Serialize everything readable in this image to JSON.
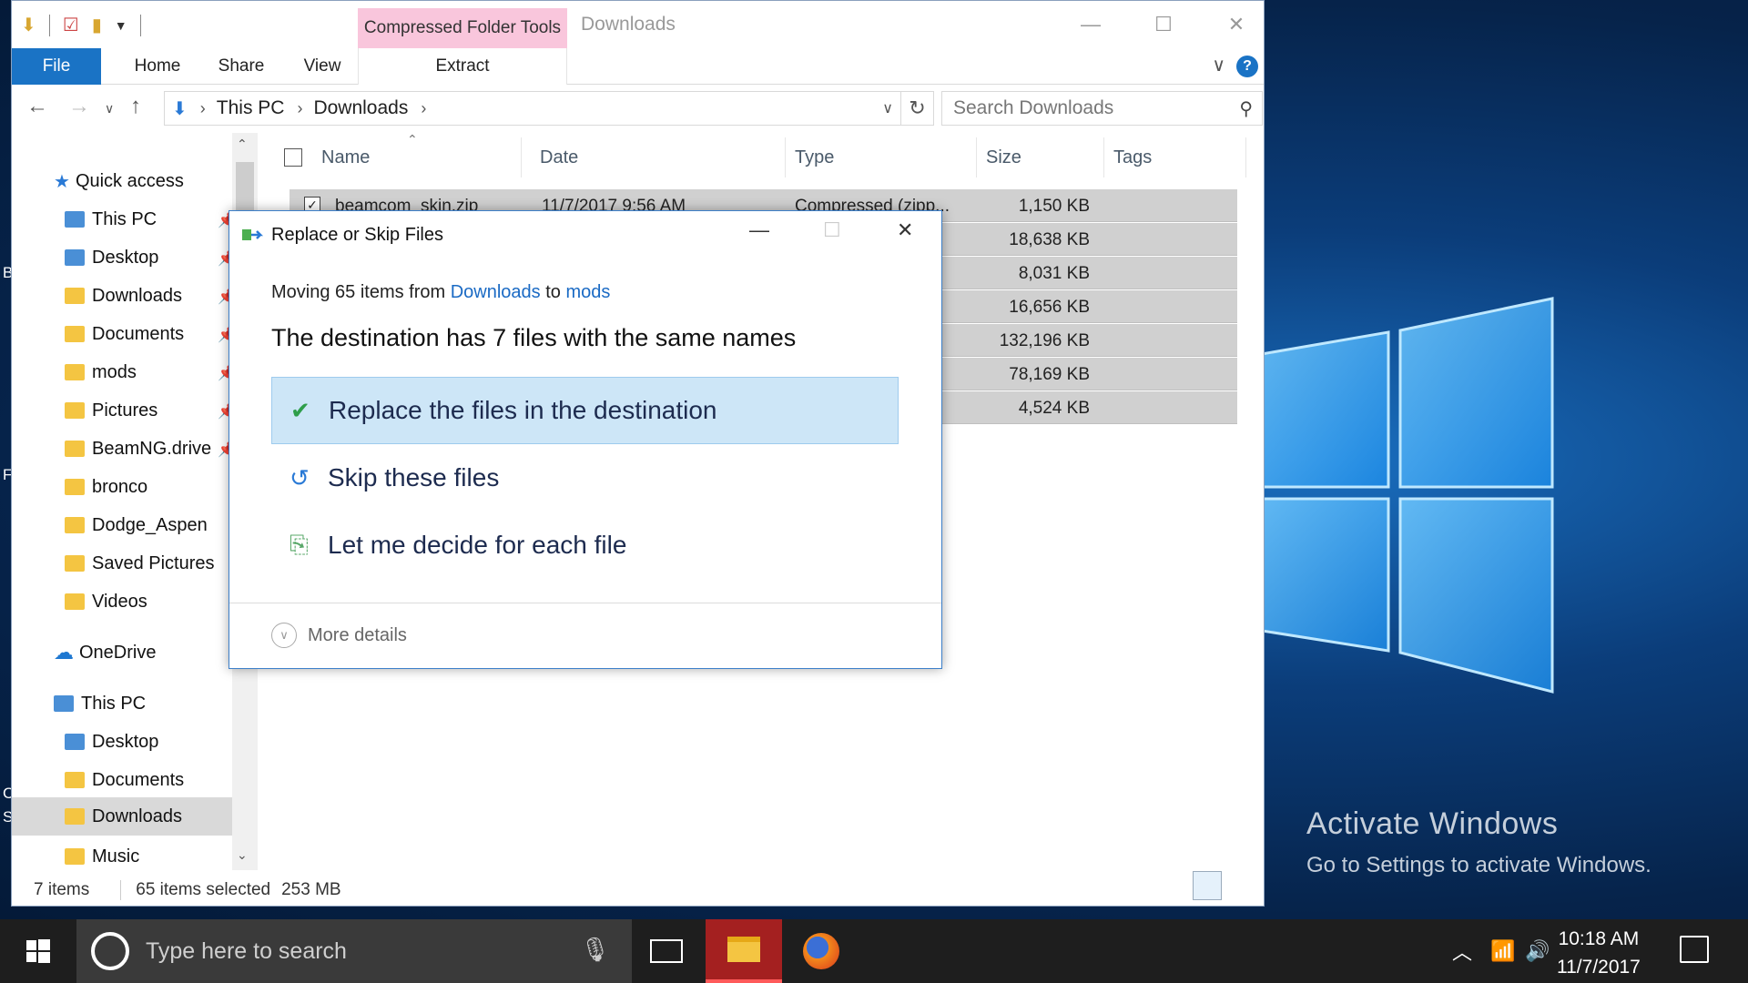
{
  "window": {
    "title": "Downloads",
    "contextual_tab": "Compressed Folder Tools",
    "ribbon_tabs": [
      "File",
      "Home",
      "Share",
      "View"
    ],
    "extract_tab": "Extract",
    "help": "?"
  },
  "address": {
    "crumbs": [
      "This PC",
      "Downloads"
    ],
    "search_placeholder": "Search Downloads"
  },
  "nav": {
    "quick_access": "Quick access",
    "items": [
      "This PC",
      "Desktop",
      "Downloads",
      "Documents",
      "mods",
      "Pictures",
      "BeamNG.drive",
      "bronco",
      "Dodge_Aspen",
      "Saved Pictures",
      "Videos"
    ],
    "onedrive": "OneDrive",
    "this_pc": "This PC",
    "pc_items": [
      "Desktop",
      "Documents",
      "Downloads",
      "Music"
    ]
  },
  "columns": [
    "Name",
    "Date",
    "Type",
    "Size",
    "Tags"
  ],
  "files": [
    {
      "name": "beamcom_skin.zip",
      "date": "11/7/2017 9:56 AM",
      "type": "Compressed (zipp...",
      "size": "1,150 KB"
    },
    {
      "name": "",
      "date": "",
      "type": "",
      "size": "18,638 KB"
    },
    {
      "name": "",
      "date": "",
      "type": "",
      "size": "8,031 KB"
    },
    {
      "name": "",
      "date": "",
      "type": "",
      "size": "16,656 KB"
    },
    {
      "name": "",
      "date": "",
      "type": "",
      "size": "132,196 KB"
    },
    {
      "name": "",
      "date": "",
      "type": "",
      "size": "78,169 KB"
    },
    {
      "name": "",
      "date": "",
      "type": "",
      "size": "4,524 KB"
    }
  ],
  "status": {
    "items": "7 items",
    "selected": "65 items selected",
    "size": "253 MB"
  },
  "dialog": {
    "title": "Replace or Skip Files",
    "moving_prefix": "Moving 65 items from",
    "source": "Downloads",
    "to_word": "to",
    "dest": "mods",
    "heading": "The destination has 7 files with the same names",
    "options": [
      "Replace the files in the destination",
      "Skip these files",
      "Let me decide for each file"
    ],
    "more_details": "More details"
  },
  "desktop": {
    "activate_title": "Activate Windows",
    "activate_sub": "Go to Settings to activate Windows.",
    "edge_letters": [
      "B",
      "F",
      "C",
      "S"
    ]
  },
  "taskbar": {
    "search_placeholder": "Type here to search",
    "time": "10:18 AM",
    "date": "11/7/2017"
  },
  "colors": {
    "accent": "#1a73c5",
    "selected_option": "#cde6f7",
    "context_tab": "#f9c6dc",
    "taskbar": "#1e1e1e"
  }
}
